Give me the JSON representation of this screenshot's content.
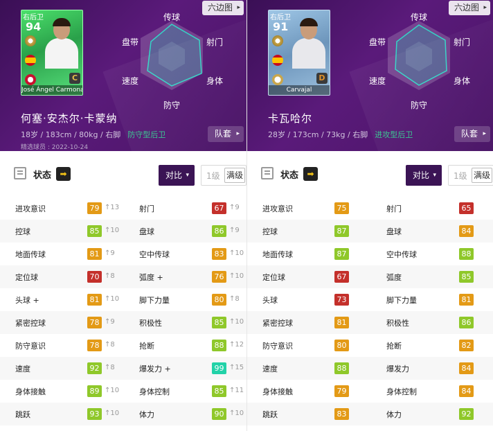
{
  "colors": {
    "green": "#8fc82a",
    "orange": "#e39a16",
    "red": "#c4302b",
    "teal": "#22d2a8",
    "header_purple": "#4a1566",
    "compare_button": "#3b1455"
  },
  "panels": [
    {
      "header": {
        "hexagon_button": "六边图",
        "card_position": "右后卫",
        "card_rating": "94",
        "card_grade": "C",
        "card_name": "José Ángel Carmona",
        "card_style": "green",
        "radar_labels": {
          "top": "传球",
          "left_top": "盘带",
          "right_top": "射门",
          "left_bottom": "速度",
          "right_bottom": "身体",
          "bottom": "防守"
        },
        "player_name": "何塞·安杰尔·卡蒙纳",
        "player_info": "18岁 / 183cm / 80kg / 右脚",
        "player_type": "防守型后卫",
        "player_date": "精选球员 : 2022-10-24",
        "team_button": "队套"
      },
      "status": {
        "title": "状态",
        "arrow": "➡",
        "compare": "对比",
        "level1": "1级",
        "full": "满级"
      },
      "stats": [
        {
          "l": "进攻意识",
          "lv": "79",
          "lc": "orange",
          "lu": "↑13",
          "r": "射门",
          "rv": "67",
          "rc": "red",
          "ru": "↑9"
        },
        {
          "l": "控球",
          "lv": "85",
          "lc": "green",
          "lu": "↑10",
          "r": "盘球",
          "rv": "86",
          "rc": "green",
          "ru": "↑9"
        },
        {
          "l": "地面传球",
          "lv": "81",
          "lc": "orange",
          "lu": "↑9",
          "r": "空中传球",
          "rv": "83",
          "rc": "orange",
          "ru": "↑10"
        },
        {
          "l": "定位球",
          "lv": "70",
          "lc": "red",
          "lu": "↑8",
          "r": "弧度 +",
          "rv": "76",
          "rc": "orange",
          "ru": "↑10"
        },
        {
          "l": "头球 +",
          "lv": "81",
          "lc": "orange",
          "lu": "↑10",
          "r": "脚下力量",
          "rv": "80",
          "rc": "orange",
          "ru": "↑8"
        },
        {
          "l": "紧密控球",
          "lv": "78",
          "lc": "orange",
          "lu": "↑9",
          "r": "积极性",
          "rv": "85",
          "rc": "green",
          "ru": "↑10"
        },
        {
          "l": "防守意识",
          "lv": "78",
          "lc": "orange",
          "lu": "↑8",
          "r": "抢断",
          "rv": "88",
          "rc": "green",
          "ru": "↑12"
        },
        {
          "l": "速度",
          "lv": "92",
          "lc": "green",
          "lu": "↑8",
          "r": "爆发力 +",
          "rv": "99",
          "rc": "teal",
          "ru": "↑15"
        },
        {
          "l": "身体接触",
          "lv": "89",
          "lc": "green",
          "lu": "↑10",
          "r": "身体控制",
          "rv": "85",
          "rc": "green",
          "ru": "↑11"
        },
        {
          "l": "跳跃",
          "lv": "93",
          "lc": "green",
          "lu": "↑10",
          "r": "体力",
          "rv": "90",
          "rc": "green",
          "ru": "↑10"
        }
      ]
    },
    {
      "header": {
        "hexagon_button": "六边图",
        "card_position": "右后卫",
        "card_rating": "91",
        "card_grade": "D",
        "card_name": "Carvajal",
        "card_style": "blue",
        "radar_labels": {
          "top": "传球",
          "left_top": "盘带",
          "right_top": "射门",
          "left_bottom": "速度",
          "right_bottom": "身体",
          "bottom": "防守"
        },
        "player_name": "卡瓦哈尔",
        "player_info": "28岁 / 173cm / 73kg / 右脚",
        "player_type": "进攻型后卫",
        "player_date": "",
        "team_button": "队套"
      },
      "status": {
        "title": "状态",
        "arrow": "➡",
        "compare": "对比",
        "level1": "1级",
        "full": "满级"
      },
      "stats": [
        {
          "l": "进攻意识",
          "lv": "75",
          "lc": "orange",
          "lu": "",
          "r": "射门",
          "rv": "65",
          "rc": "red",
          "ru": ""
        },
        {
          "l": "控球",
          "lv": "87",
          "lc": "green",
          "lu": "",
          "r": "盘球",
          "rv": "84",
          "rc": "orange",
          "ru": ""
        },
        {
          "l": "地面传球",
          "lv": "87",
          "lc": "green",
          "lu": "",
          "r": "空中传球",
          "rv": "88",
          "rc": "green",
          "ru": ""
        },
        {
          "l": "定位球",
          "lv": "67",
          "lc": "red",
          "lu": "",
          "r": "弧度",
          "rv": "85",
          "rc": "green",
          "ru": ""
        },
        {
          "l": "头球",
          "lv": "73",
          "lc": "red",
          "lu": "",
          "r": "脚下力量",
          "rv": "81",
          "rc": "orange",
          "ru": ""
        },
        {
          "l": "紧密控球",
          "lv": "81",
          "lc": "orange",
          "lu": "",
          "r": "积极性",
          "rv": "86",
          "rc": "green",
          "ru": ""
        },
        {
          "l": "防守意识",
          "lv": "80",
          "lc": "orange",
          "lu": "",
          "r": "抢断",
          "rv": "82",
          "rc": "orange",
          "ru": ""
        },
        {
          "l": "速度",
          "lv": "88",
          "lc": "green",
          "lu": "",
          "r": "爆发力",
          "rv": "84",
          "rc": "orange",
          "ru": ""
        },
        {
          "l": "身体接触",
          "lv": "79",
          "lc": "orange",
          "lu": "",
          "r": "身体控制",
          "rv": "84",
          "rc": "orange",
          "ru": ""
        },
        {
          "l": "跳跃",
          "lv": "83",
          "lc": "orange",
          "lu": "",
          "r": "体力",
          "rv": "92",
          "rc": "green",
          "ru": ""
        }
      ]
    }
  ]
}
